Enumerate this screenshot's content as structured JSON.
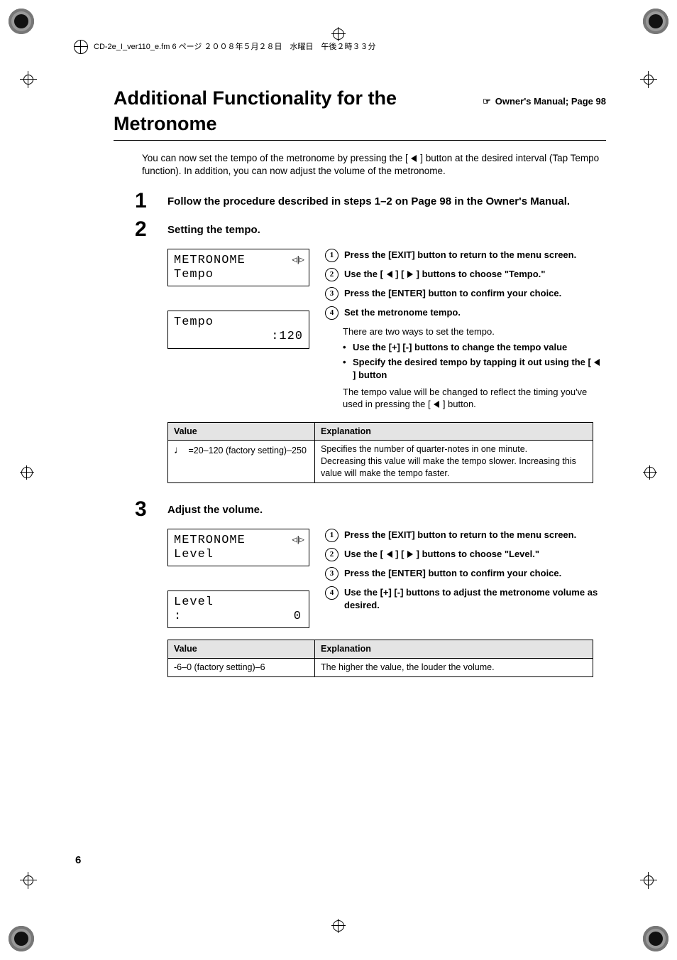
{
  "runheader": "CD-2e_I_ver110_e.fm 6 ページ ２００８年５月２８日　水曜日　午後２時３３分",
  "title": "Additional Functionality for the Metronome",
  "title_ref_icon": "☞",
  "title_ref": "Owner's Manual; Page 98",
  "intro_a": "You can now set the tempo of the metronome by pressing the [ ",
  "intro_b": " ] button at the desired interval (Tap Tempo function). In addition, you can now adjust the volume of the metronome.",
  "step1": {
    "num": "1",
    "head": "Follow the procedure described in steps 1–2 on Page 98 in the Owner's Manual."
  },
  "step2": {
    "num": "2",
    "head": "Setting the tempo.",
    "lcd1": {
      "l1": "METRONOME",
      "l2": "Tempo"
    },
    "lcd2": {
      "l1": "Tempo",
      "l2a": "",
      "l2b": ":120"
    },
    "i1": "Press the [EXIT] button to return to the menu screen.",
    "i2a": "Use the [ ",
    "i2b": " ] [ ",
    "i2c": " ] buttons to choose \"Tempo.\"",
    "i3": "Press the [ENTER] button to confirm your choice.",
    "i4": "Set the metronome tempo.",
    "i4_sub": "There are two ways to set the tempo.",
    "i4_b1": "Use the [+] [-] buttons to change the tempo value",
    "i4_b2a": "Specify the desired tempo by tapping it out using the [ ",
    "i4_b2b": " ] button",
    "i4_note_a": "The tempo value will be changed to reflect the timing you've used in pressing the [ ",
    "i4_note_b": " ] button.",
    "table": {
      "h1": "Value",
      "h2": "Explanation",
      "v": " =20–120 (factory setting)–250",
      "e": "Specifies the number of quarter-notes in one minute.\nDecreasing this value will make the tempo slower. Increasing this value will make the tempo faster."
    }
  },
  "step3": {
    "num": "3",
    "head": "Adjust the volume.",
    "lcd1": {
      "l1": "METRONOME",
      "l2": "Level"
    },
    "lcd2": {
      "l1": "Level",
      "l2a": ":",
      "l2b": "0"
    },
    "i1": "Press the [EXIT] button to return to the menu screen.",
    "i2a": "Use the [ ",
    "i2b": " ] [ ",
    "i2c": " ] buttons to choose \"Level.\"",
    "i3": "Press the [ENTER] button to confirm your choice.",
    "i4": "Use the [+] [-] buttons to adjust the metronome volume as desired.",
    "table": {
      "h1": "Value",
      "h2": "Explanation",
      "v": "-6–0 (factory setting)–6",
      "e": "The higher the value, the louder the volume."
    }
  },
  "page_number": "6",
  "circled": {
    "c1": "1",
    "c2": "2",
    "c3": "3",
    "c4": "4"
  },
  "note_glyph": "♩"
}
